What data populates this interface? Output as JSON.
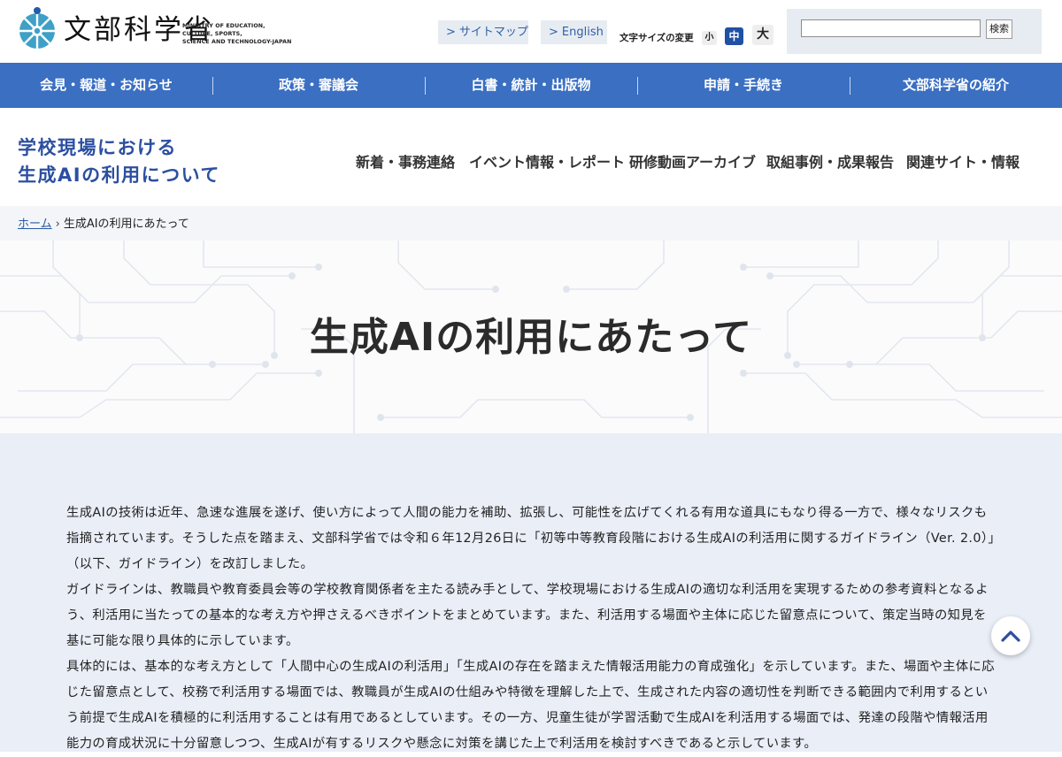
{
  "header": {
    "logo_text": "文部科学省",
    "logo_en": "MINISTRY OF EDUCATION,\nCULTURE, SPORTS,\nSCIENCE AND TECHNOLOGY-JAPAN",
    "links": [
      {
        "label": "サイトマップ",
        "arrow": ">"
      },
      {
        "label": "English",
        "arrow": ">"
      }
    ],
    "font_size": {
      "label": "文字サイズの変更",
      "small": "小",
      "medium": "中",
      "large": "大",
      "selected": "中"
    },
    "search": {
      "value": "",
      "button": "検索"
    }
  },
  "global_nav": [
    "会見・報道・お知らせ",
    "政策・審議会",
    "白書・統計・出版物",
    "申請・手続き",
    "文部科学省の紹介"
  ],
  "site": {
    "title_line1": "学校現場における",
    "title_line2": "生成AIの利用について",
    "subnav": [
      "新着・事務連絡",
      "イベント情報・レポート",
      "研修動画アーカイブ",
      "取組事例・成果報告",
      "関連サイト・情報"
    ]
  },
  "breadcrumb": {
    "home": "ホーム",
    "separator": "›",
    "current": "生成AIの利用にあたって"
  },
  "page_title": "生成AIの利用にあたって",
  "body": [
    "生成AIの技術は近年、急速な進展を遂げ、使い方によって人間の能力を補助、拡張し、可能性を広げてくれる有用な道具にもなり得る一方で、様々なリスクも指摘されています。そうした点を踏まえ、文部科学省では令和６年12月26日に「初等中等教育段階における生成AIの利活用に関するガイドライン（Ver. 2.0）」（以下、ガイドライン）を改訂しました。",
    "ガイドラインは、教職員や教育委員会等の学校教育関係者を主たる読み手として、学校現場における生成AIの適切な利活用を実現するための参考資料となるよう、利活用に当たっての基本的な考え方や押さえるべきポイントをまとめています。また、利活用する場面や主体に応じた留意点について、策定当時の知見を基に可能な限り具体的に示しています。",
    "具体的には、基本的な考え方として「人間中心の生成AIの利活用」「生成AIの存在を踏まえた情報活用能力の育成強化」を示しています。また、場面や主体に応じた留意点として、校務で利活用する場面では、教職員が生成AIの仕組みや特徴を理解した上で、生成された内容の適切性を判断できる範囲内で利用するという前提で生成AIを積極的に利活用することは有用であるとしています。その一方、児童生徒が学習活動で生成AIを利活用する場面では、発達の段階や情報活用能力の育成状況に十分留意しつつ、生成AIが有するリスクや懸念に対策を講じた上で利活用を検討すべきであると示しています。"
  ],
  "colors": {
    "nav_blue": "#3a6fc2",
    "title_blue": "#2c4fa0",
    "content_bg": "#e9eef7",
    "link_blue": "#2a5aa6"
  },
  "icons": {
    "logo": "mext-logo-mark",
    "back_to_top": "chevron-up-icon"
  }
}
